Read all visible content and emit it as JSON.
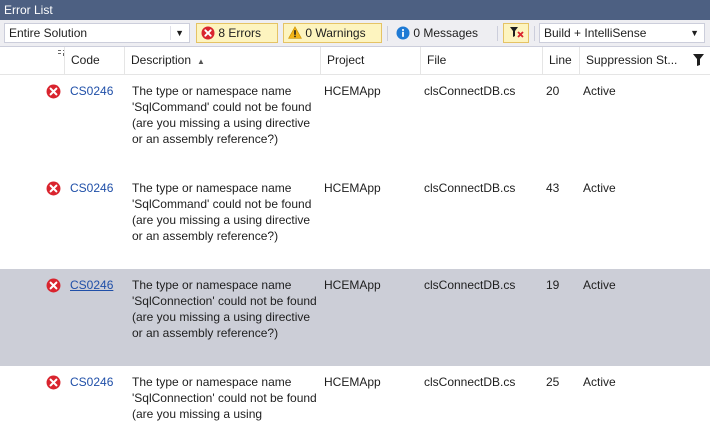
{
  "window": {
    "title": "Error List"
  },
  "toolbar": {
    "scope_selected": "Entire Solution",
    "errors_label": "8 Errors",
    "warnings_label": "0 Warnings",
    "messages_label": "0 Messages",
    "source_selected": "Build + IntelliSense"
  },
  "columns": {
    "code": "Code",
    "description": "Description",
    "project": "Project",
    "file": "File",
    "line": "Line",
    "suppression": "Suppression St..."
  },
  "rows": [
    {
      "code": "CS0246",
      "description": "The type or namespace name 'SqlCommand' could not be found (are you missing a using directive or an assembly reference?)",
      "project": "HCEMApp",
      "file": "clsConnectDB.cs",
      "line": "20",
      "suppression": "Active"
    },
    {
      "code": "CS0246",
      "description": "The type or namespace name 'SqlCommand' could not be found (are you missing a using directive or an assembly reference?)",
      "project": "HCEMApp",
      "file": "clsConnectDB.cs",
      "line": "43",
      "suppression": "Active"
    },
    {
      "code": "CS0246",
      "description": "The type or namespace name 'SqlConnection' could not be found (are you missing a using directive or an assembly reference?)",
      "project": "HCEMApp",
      "file": "clsConnectDB.cs",
      "line": "19",
      "suppression": "Active"
    },
    {
      "code": "CS0246",
      "description": "The type or namespace name 'SqlConnection' could not be found (are you missing a using",
      "project": "HCEMApp",
      "file": "clsConnectDB.cs",
      "line": "25",
      "suppression": "Active"
    }
  ],
  "colors": {
    "title_bar": "#4d6082",
    "toolbar_bg": "#eeeef2",
    "selected_row": "#ccced7",
    "error_red": "#d9242e",
    "warning_yellow": "#f2b418",
    "info_blue": "#1f7ad4",
    "link_blue": "#1f4fa8"
  },
  "icons": {
    "error": "error-circle-x-icon",
    "warning": "warning-triangle-icon",
    "message": "info-circle-icon",
    "filter": "filter-toggle-icon",
    "sort": "sort-ascending-icon",
    "column_filter": "funnel-icon"
  }
}
